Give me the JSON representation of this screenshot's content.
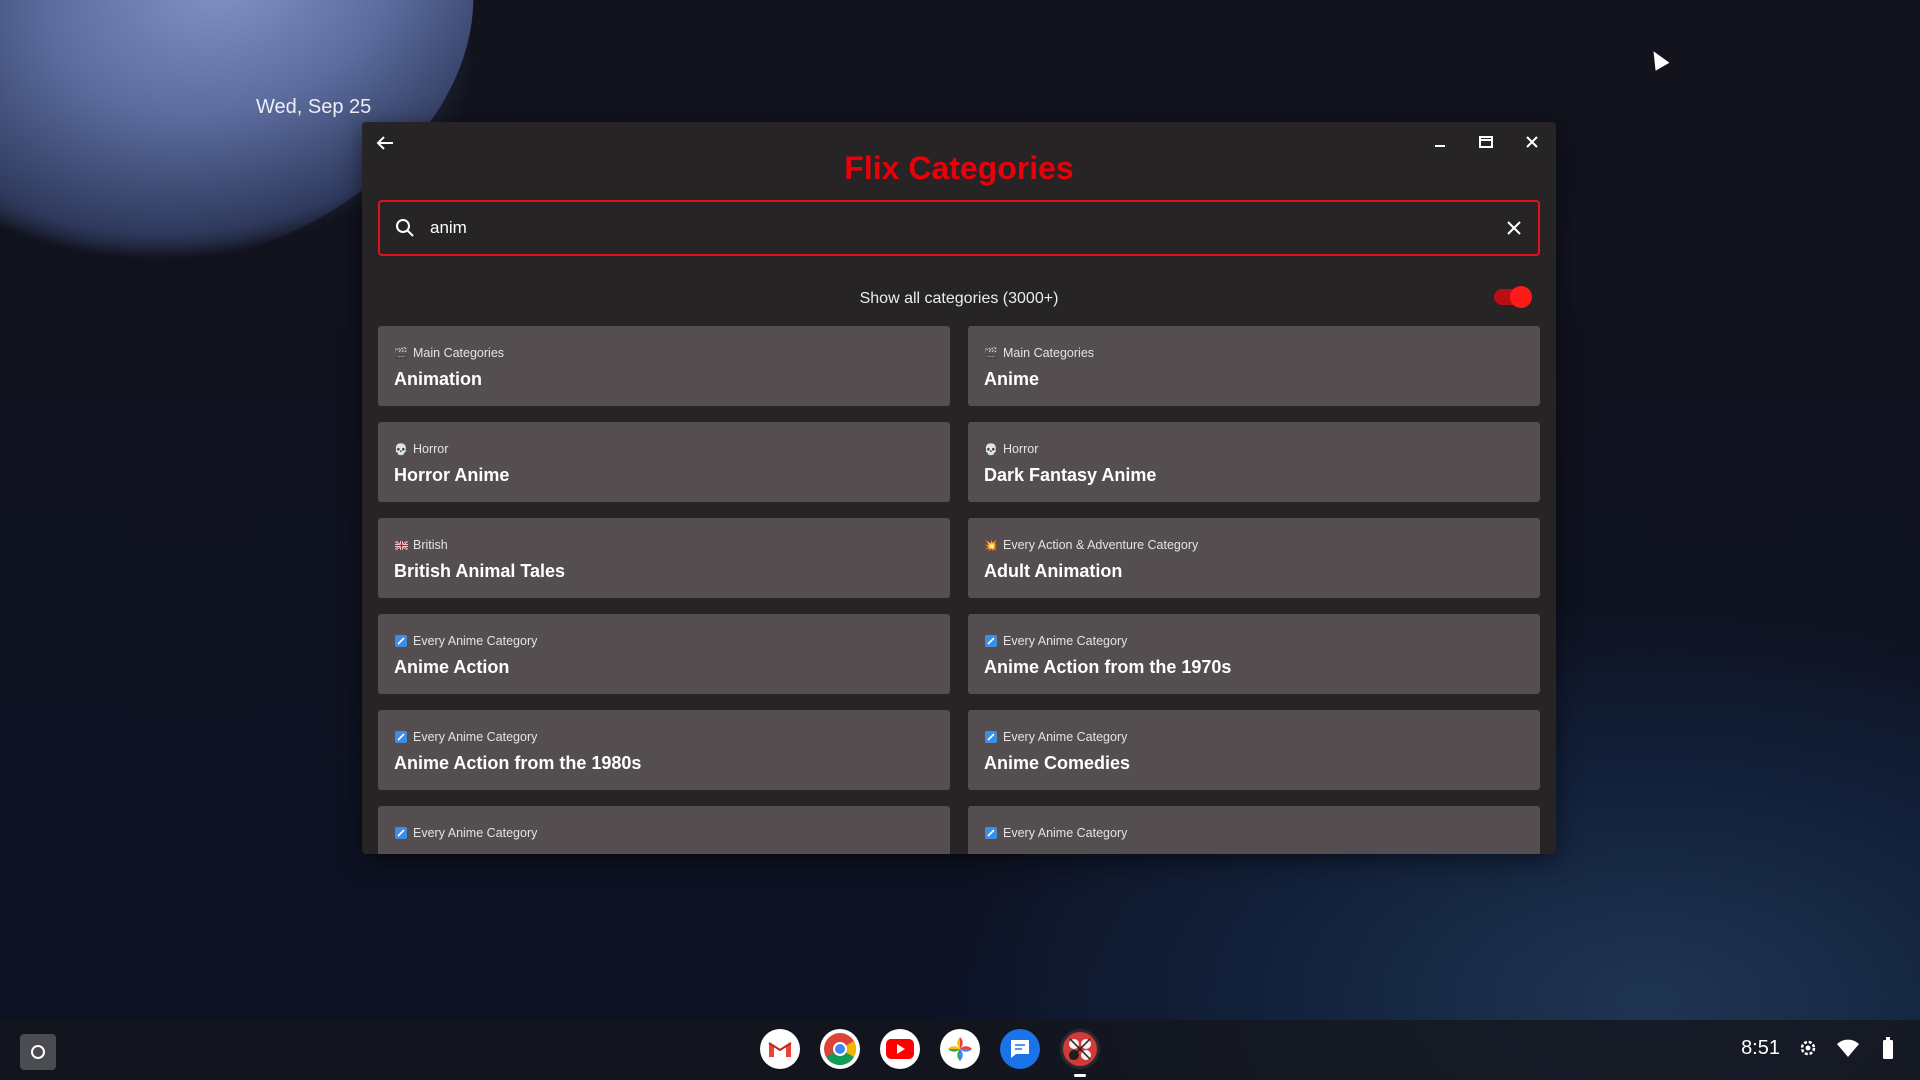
{
  "desktop": {
    "date": "Wed, Sep 25"
  },
  "app": {
    "title": "Flix Categories",
    "search": {
      "value": "anim",
      "placeholder": ""
    },
    "toggle": {
      "label": "Show all categories (3000+)",
      "on": true
    },
    "colors": {
      "accent": "#e8000b",
      "card_bg": "#554e51",
      "window_bg": "#262425"
    },
    "cards": [
      {
        "icon": "clapperboard-icon",
        "category": "Main Categories",
        "title": "Animation"
      },
      {
        "icon": "clapperboard-icon",
        "category": "Main Categories",
        "title": "Anime"
      },
      {
        "icon": "skull-icon",
        "category": "Horror",
        "title": "Horror Anime"
      },
      {
        "icon": "skull-icon",
        "category": "Horror",
        "title": "Dark Fantasy Anime"
      },
      {
        "icon": "uk-flag-icon",
        "category": "British",
        "title": "British Animal Tales"
      },
      {
        "icon": "explosion-icon",
        "category": "Every Action & Adventure Category",
        "title": "Adult Animation"
      },
      {
        "icon": "brush-icon",
        "category": "Every Anime Category",
        "title": "Anime Action"
      },
      {
        "icon": "brush-icon",
        "category": "Every Anime Category",
        "title": "Anime Action from the 1970s"
      },
      {
        "icon": "brush-icon",
        "category": "Every Anime Category",
        "title": "Anime Action from the 1980s"
      },
      {
        "icon": "brush-icon",
        "category": "Every Anime Category",
        "title": "Anime Comedies"
      },
      {
        "icon": "brush-icon",
        "category": "Every Anime Category",
        "title": ""
      },
      {
        "icon": "brush-icon",
        "category": "Every Anime Category",
        "title": ""
      }
    ]
  },
  "shelf": {
    "apps": [
      "gmail-icon",
      "chrome-icon",
      "youtube-icon",
      "photos-icon",
      "messages-icon",
      "flix-app-icon"
    ],
    "time": "8:51"
  }
}
